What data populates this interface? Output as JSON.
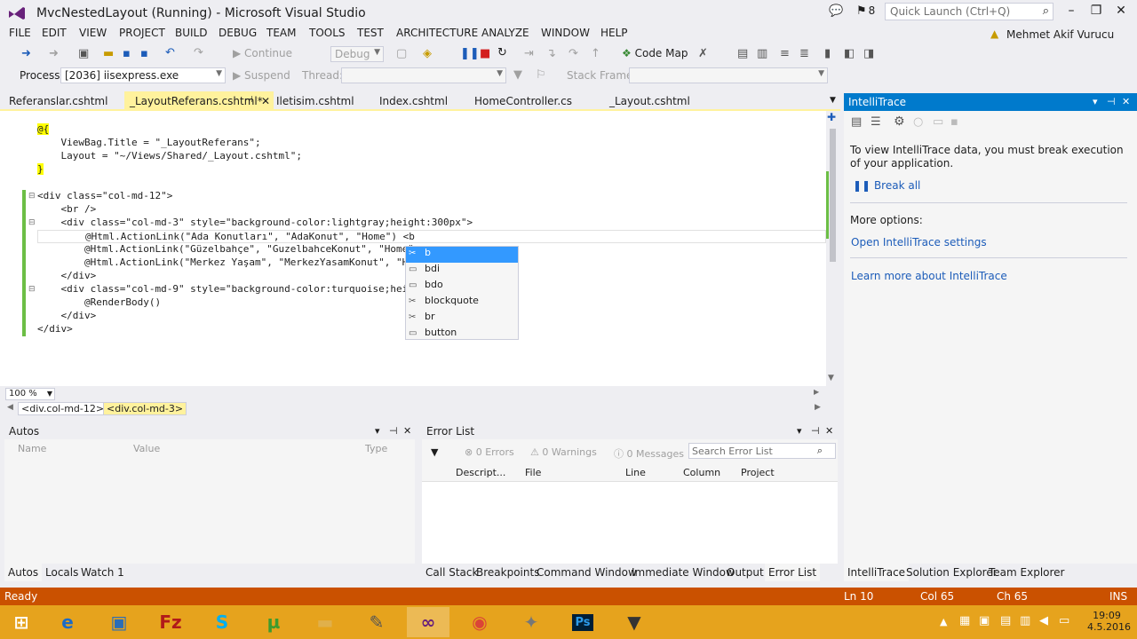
{
  "window": {
    "title": "MvcNestedLayout (Running) - Microsoft Visual Studio",
    "notification_count": "8",
    "quick_launch_placeholder": "Quick Launch (Ctrl+Q)",
    "user": "Mehmet Akif Vurucu"
  },
  "menu": [
    "FILE",
    "EDIT",
    "VIEW",
    "PROJECT",
    "BUILD",
    "DEBUG",
    "TEAM",
    "TOOLS",
    "TEST",
    "ARCHITECTURE",
    "ANALYZE",
    "WINDOW",
    "HELP"
  ],
  "toolbar": {
    "continue_label": "Continue",
    "config_value": "Debug",
    "code_map_label": "Code Map",
    "process_label": "Process:",
    "process_value": "[2036] iisexpress.exe",
    "suspend_label": "Suspend",
    "thread_label": "Thread:",
    "stack_frame_label": "Stack Frame:"
  },
  "doc_tabs": {
    "items": [
      "Referanslar.cshtml",
      "_LayoutReferans.cshtml*",
      "Iletisim.cshtml",
      "Index.cshtml",
      "HomeController.cs",
      "_Layout.cshtml"
    ]
  },
  "editor": {
    "lines": [
      "@{",
      "    ViewBag.Title = \"_LayoutReferans\";",
      "    Layout = \"~/Views/Shared/_Layout.cshtml\";",
      "}",
      "",
      "<div class=\"col-md-12\">",
      "    <br />",
      "    <div class=\"col-md-3\" style=\"background-color:lightgray;height:300px\">",
      "        @Html.ActionLink(\"Ada Konutları\", \"AdaKonut\", \"Home\") <b",
      "        @Html.ActionLink(\"Güzelbahçe\", \"GuzelbahceKonut\", \"Home\"",
      "        @Html.ActionLink(\"Merkez Yaşam\", \"MerkezYasamKonut\", \"H",
      "    </div>",
      "    <div class=\"col-md-9\" style=\"background-color:turquoise;hei",
      "        @RenderBody()",
      "    </div>",
      "</div>"
    ],
    "zoom": "100 %",
    "breadcrumbs": [
      "<div.col-md-12>",
      "<div.col-md-3>"
    ]
  },
  "completion": {
    "items": [
      {
        "label": "b",
        "icon": "snippet-icon"
      },
      {
        "label": "bdi",
        "icon": "element-icon"
      },
      {
        "label": "bdo",
        "icon": "element-icon"
      },
      {
        "label": "blockquote",
        "icon": "snippet-icon"
      },
      {
        "label": "br",
        "icon": "snippet-icon"
      },
      {
        "label": "button",
        "icon": "element-icon"
      }
    ],
    "selected": 0
  },
  "autos": {
    "title": "Autos",
    "columns": [
      "Name",
      "Value",
      "Type"
    ],
    "tabs": [
      "Autos",
      "Locals",
      "Watch 1"
    ]
  },
  "error_list": {
    "title": "Error List",
    "errors": "0 Errors",
    "warnings": "0 Warnings",
    "messages": "0 Messages",
    "search_placeholder": "Search Error List",
    "columns": [
      "Descript...",
      "File",
      "Line",
      "Column",
      "Project"
    ],
    "tabs": [
      "Call Stack",
      "Breakpoints",
      "Command Window",
      "Immediate Window",
      "Output",
      "Error List"
    ]
  },
  "intellitrace": {
    "title": "IntelliTrace",
    "message": "To view IntelliTrace data, you must break execution of your application.",
    "break_all": "Break all",
    "more_options": "More options:",
    "open_settings": "Open IntelliTrace settings",
    "learn_more": "Learn more about IntelliTrace",
    "tabs": [
      "IntelliTrace",
      "Solution Explorer",
      "Team Explorer"
    ]
  },
  "status": {
    "ready": "Ready",
    "ln": "Ln 10",
    "col": "Col 65",
    "ch": "Ch 65",
    "ins": "INS"
  },
  "taskbar": {
    "time": "19:09",
    "date": "4.5.2016",
    "colors": {
      "taskbar": "#E6A31D",
      "status": "#CA5100",
      "accent": "#007ACC"
    }
  }
}
